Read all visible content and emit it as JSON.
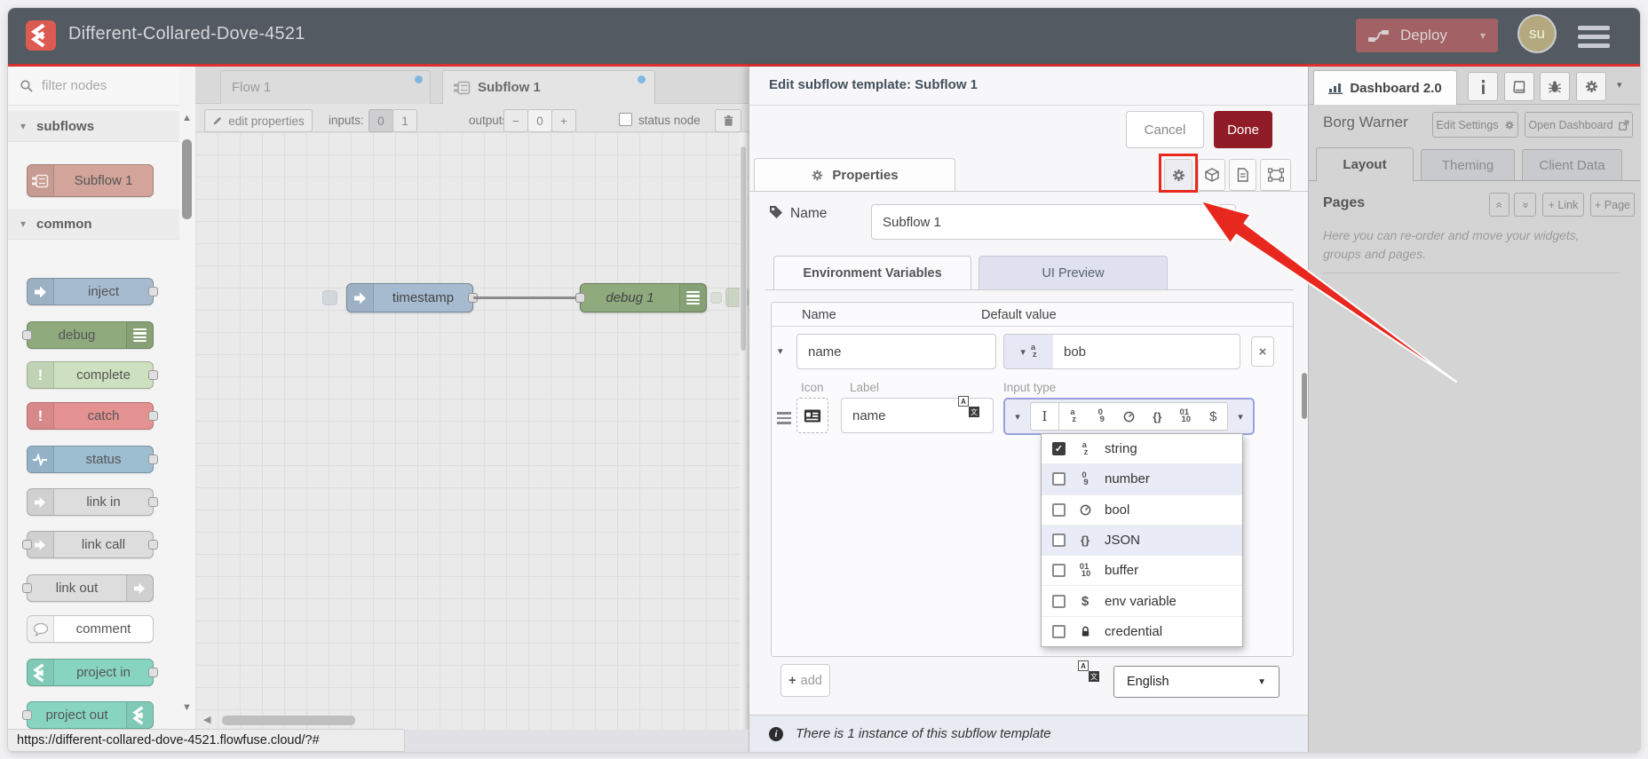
{
  "colors": {
    "header_bg": "#545a62",
    "accent_red": "#d93030",
    "annotation": "#e8281e",
    "deploy_bg": "#a16165",
    "avatar_bg": "#b4a97e",
    "done_bg": "#8f1c26",
    "logo_red": "#dd5a52",
    "subflow_node": "#d2a49a",
    "inject": "#a6bbcf",
    "debug": "#8faa7d",
    "complete": "#cde0c0",
    "catch": "#e49191",
    "status": "#9dbdd1",
    "link": "#dddddd",
    "comment": "#ffffff",
    "project": "#87d5c1",
    "lavender": "#e6e8f5",
    "focus": "#98a0dd",
    "stripe": "#e9ebf6",
    "tab_dot": "#6fb0e0"
  },
  "header": {
    "title": "Different-Collared-Dove-4521",
    "deploy_label": "Deploy",
    "avatar_initials": "su"
  },
  "palette": {
    "filter_placeholder": "filter nodes",
    "sections": [
      {
        "label": "subflows",
        "items": [
          {
            "label": "Subflow 1"
          }
        ]
      },
      {
        "label": "common",
        "items": [
          {
            "label": "inject"
          },
          {
            "label": "debug"
          },
          {
            "label": "complete"
          },
          {
            "label": "catch"
          },
          {
            "label": "status"
          },
          {
            "label": "link in"
          },
          {
            "label": "link call"
          },
          {
            "label": "link out"
          },
          {
            "label": "comment"
          },
          {
            "label": "project in"
          },
          {
            "label": "project out"
          }
        ]
      }
    ]
  },
  "workspace": {
    "tabs": [
      {
        "label": "Flow 1"
      },
      {
        "label": "Subflow 1"
      }
    ],
    "toolbar": {
      "edit_properties": "edit properties",
      "inputs_label": "inputs:",
      "input_options": [
        "0",
        "1"
      ],
      "outputs_label": "outputs:",
      "outputs_value": "0",
      "minus": "−",
      "plus": "+",
      "status_node": "status node"
    },
    "nodes": [
      {
        "label": "timestamp"
      },
      {
        "label": "debug 1"
      }
    ]
  },
  "tray": {
    "title": "Edit subflow template: Subflow 1",
    "cancel": "Cancel",
    "done": "Done",
    "properties_tab": "Properties",
    "name_label": "Name",
    "name_value": "Subflow 1",
    "tabs": {
      "env": "Environment Variables",
      "ui": "UI Preview"
    },
    "table": {
      "col_name": "Name",
      "col_default": "Default value",
      "row": {
        "name": "name",
        "value": "bob"
      }
    },
    "detail": {
      "icon_label": "Icon",
      "label_label": "Label",
      "label_value": "name",
      "input_type_label": "Input type"
    },
    "types": [
      {
        "label": "string",
        "checked": true
      },
      {
        "label": "number",
        "checked": false
      },
      {
        "label": "bool",
        "checked": false
      },
      {
        "label": "JSON",
        "checked": false
      },
      {
        "label": "buffer",
        "checked": false
      },
      {
        "label": "env variable",
        "checked": false
      },
      {
        "label": "credential",
        "checked": false
      }
    ],
    "add_label": "add",
    "language": "English",
    "footer_note": "There is 1 instance of this subflow template"
  },
  "sidebar": {
    "dashboard_tab": "Dashboard 2.0",
    "team": "Borg Warner",
    "edit_settings": "Edit Settings",
    "open_dashboard": "Open Dashboard",
    "tabs": [
      {
        "label": "Layout"
      },
      {
        "label": "Theming"
      },
      {
        "label": "Client Data"
      }
    ],
    "pages": {
      "title": "Pages",
      "link_button": "+ Link",
      "page_button": "+ Page",
      "help": "Here you can re-order and move your widgets, groups and pages."
    }
  },
  "statusbar": {
    "url": "https://different-collared-dove-4521.flowfuse.cloud/?#"
  },
  "glyphs": {
    "check": "✓",
    "caret": "▾",
    "up": "▲",
    "down": "▼",
    "left": "◀",
    "x": "×",
    "json": "{}",
    "dollar": "$",
    "ibeam": "I",
    "az": [
      "a",
      "z"
    ],
    "n09": [
      "0",
      "9"
    ],
    "bin": [
      "01",
      "10"
    ],
    "chevrons": "«"
  }
}
